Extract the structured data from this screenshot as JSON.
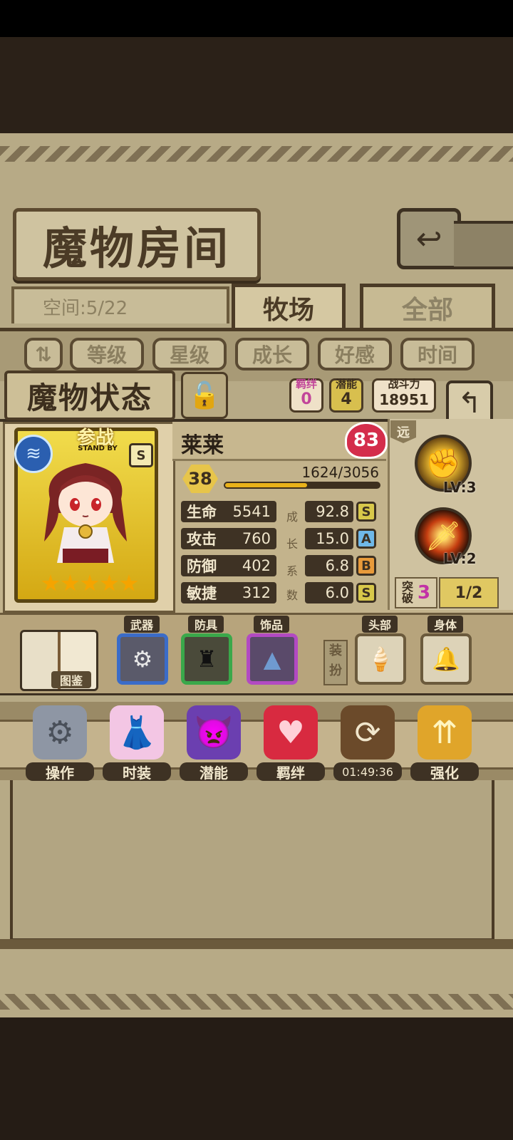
{
  "room": {
    "title": "魔物房间",
    "space": "空间:5/22",
    "tabs": [
      "牧场",
      "全部"
    ],
    "sort_buttons": [
      "等级",
      "星级",
      "成长",
      "好感",
      "时间"
    ]
  },
  "status": {
    "title": "魔物状态",
    "bond_label": "羁绊",
    "bond_value": "0",
    "potential_label": "潜能",
    "potential_value": "4",
    "power_label": "战斗力",
    "power_value": "18951"
  },
  "character": {
    "standby_label": "参战",
    "standby_sub": "STAND BY",
    "rank": "S",
    "name": "莱莱",
    "affection": "83",
    "level": "38",
    "exp_text": "1624/3056",
    "exp_fraction": 0.531,
    "star_count": 5,
    "stats": [
      {
        "label": "生命",
        "value": "5541",
        "growth": "92.8",
        "grade": "S"
      },
      {
        "label": "攻击",
        "value": "760",
        "growth": "15.0",
        "grade": "A"
      },
      {
        "label": "防御",
        "value": "402",
        "growth": "6.8",
        "grade": "B"
      },
      {
        "label": "敏捷",
        "value": "312",
        "growth": "6.0",
        "grade": "S"
      }
    ],
    "growth_vertical": [
      "成",
      "长",
      "系",
      "数"
    ]
  },
  "skills": {
    "range_tag": "远",
    "skill1_level": "LV:3",
    "skill2_level": "LV:2",
    "break_label": "突破",
    "break_value": "3",
    "break_progress": "1/2"
  },
  "equipment": {
    "book_label": "图鉴",
    "tags": {
      "weapon": "武器",
      "armor": "防具",
      "accessory": "饰品",
      "head": "头部",
      "body": "身体"
    },
    "vertical_label": [
      "装",
      "扮"
    ]
  },
  "actions": [
    {
      "label": "操作",
      "icon": "gear-icon"
    },
    {
      "label": "时装",
      "icon": "outfit-icon"
    },
    {
      "label": "潜能",
      "icon": "potential-demon-icon"
    },
    {
      "label": "羁绊",
      "icon": "bond-hearts-icon"
    },
    {
      "label": "01:49:36",
      "icon": "refresh-chest-icon"
    },
    {
      "label": "强化",
      "icon": "upgrade-arrows-icon"
    }
  ],
  "colors": {
    "grade_S": "#d8c84a",
    "grade_A": "#6fb8e8",
    "grade_B": "#e89a3a",
    "accent_gold": "#e9b21a"
  }
}
